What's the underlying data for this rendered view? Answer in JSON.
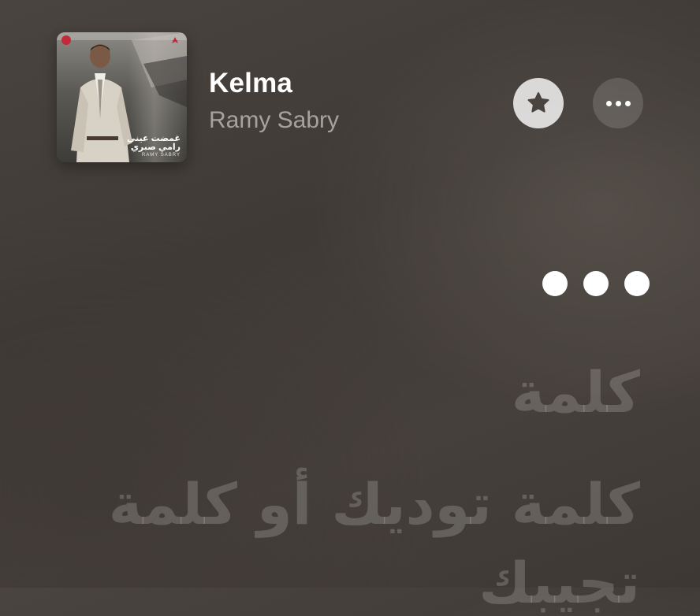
{
  "now_playing": {
    "title": "Kelma",
    "artist": "Ramy Sabry",
    "artwork": {
      "caption_line1": "غمضت عيني",
      "caption_line2": "رامي صبري",
      "caption_en": "RAMY SABRY"
    }
  },
  "controls": {
    "favorite_icon": "star-icon",
    "more_icon": "ellipsis-icon"
  },
  "lyrics": {
    "interlude_icon": "interlude-dots",
    "lines": [
      "كلمة",
      "كلمة توديك أو كلمة",
      "تجيبك"
    ]
  },
  "colors": {
    "background": "#443e3a",
    "title": "#ffffff",
    "artist": "#a29d99",
    "lyrics_inactive": "#6a6460"
  }
}
